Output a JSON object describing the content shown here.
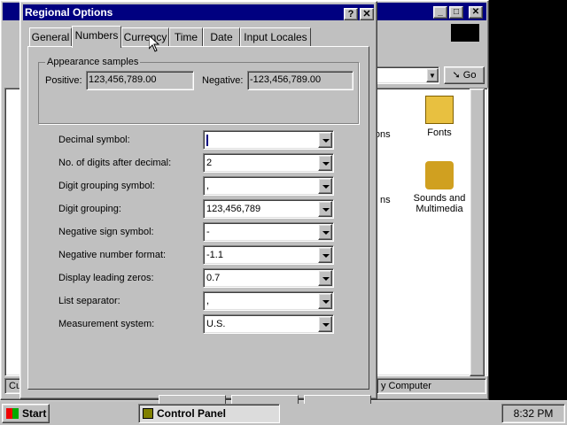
{
  "background_window": {
    "title": "",
    "toolbar": {
      "go_label": "Go"
    },
    "items": [
      {
        "label": "Fonts"
      },
      {
        "label": "Sounds and Multimedia"
      },
      {
        "label": "ptions"
      },
      {
        "label": "nal ns"
      }
    ],
    "status": {
      "left": "Cus",
      "right": "y Computer"
    }
  },
  "taskbar": {
    "start_label": "Start",
    "task_label": "Control Panel",
    "clock": "8:32 PM"
  },
  "dialog": {
    "title": "Regional Options",
    "help_label": "?",
    "close_label": "✕",
    "tabs": [
      "General",
      "Numbers",
      "Currency",
      "Time",
      "Date",
      "Input Locales"
    ],
    "active_tab": "Numbers",
    "appearance": {
      "legend": "Appearance samples",
      "positive_label": "Positive:",
      "positive_value": "123,456,789.00",
      "negative_label": "Negative:",
      "negative_value": "-123,456,789.00"
    },
    "fields": [
      {
        "label": "Decimal symbol:",
        "value": ""
      },
      {
        "label": "No. of digits after decimal:",
        "value": "2"
      },
      {
        "label": "Digit grouping symbol:",
        "value": ","
      },
      {
        "label": "Digit grouping:",
        "value": "123,456,789"
      },
      {
        "label": "Negative sign symbol:",
        "value": "-"
      },
      {
        "label": "Negative number format:",
        "value": "-1.1"
      },
      {
        "label": "Display leading zeros:",
        "value": "0.7"
      },
      {
        "label": "List separator:",
        "value": ","
      },
      {
        "label": "Measurement system:",
        "value": "U.S."
      }
    ]
  },
  "colors": {
    "title_active": "#000080",
    "face": "#c0c0c0",
    "desktop": "#000000"
  }
}
